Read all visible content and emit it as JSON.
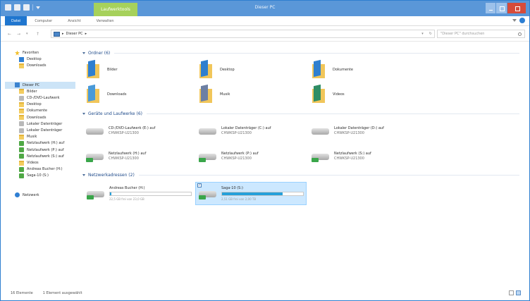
{
  "window": {
    "title": "Dieser PC",
    "context_tab": "Laufwerktools"
  },
  "ribbon": {
    "tabs": [
      "Datei",
      "Computer",
      "Ansicht",
      "Verwalten"
    ]
  },
  "address": {
    "path": [
      "Dieser PC"
    ],
    "search_placeholder": "\"Dieser PC\" durchsuchen"
  },
  "nav": {
    "favorites_label": "Favoriten",
    "favorites": [
      {
        "label": "Desktop",
        "icon": "desktop-icon"
      },
      {
        "label": "Downloads",
        "icon": "downloads-folder-icon"
      }
    ],
    "thispc_label": "Dieser PC",
    "thispc_items": [
      {
        "label": "Bilder",
        "icon": "folder-icon"
      },
      {
        "label": "CD-/DVD-Laufwerk",
        "icon": "drive-icon"
      },
      {
        "label": "Desktop",
        "icon": "folder-icon"
      },
      {
        "label": "Dokumente",
        "icon": "folder-icon"
      },
      {
        "label": "Downloads",
        "icon": "folder-icon"
      },
      {
        "label": "Lokaler Datenträger",
        "icon": "drive-icon"
      },
      {
        "label": "Lokaler Datenträger",
        "icon": "drive-icon"
      },
      {
        "label": "Musik",
        "icon": "folder-icon"
      },
      {
        "label": "Netzlaufwerk (H:) auf",
        "icon": "network-drive-icon"
      },
      {
        "label": "Netzlaufwerk (P:) auf",
        "icon": "network-drive-icon"
      },
      {
        "label": "Netzlaufwerk (S:) auf",
        "icon": "network-drive-icon"
      },
      {
        "label": "Videos",
        "icon": "folder-icon"
      },
      {
        "label": "Andreas Bucher (H:)",
        "icon": "network-drive-icon"
      },
      {
        "label": "Saga-10 (S:)",
        "icon": "network-drive-icon"
      }
    ],
    "network_label": "Netzwerk"
  },
  "content": {
    "folders_header": "Ordner (6)",
    "folders": [
      {
        "label": "Bilder",
        "kind": "pictures"
      },
      {
        "label": "Desktop",
        "kind": "desktop"
      },
      {
        "label": "Dokumente",
        "kind": "documents"
      },
      {
        "label": "Downloads",
        "kind": "downloads"
      },
      {
        "label": "Musik",
        "kind": "music"
      },
      {
        "label": "Videos",
        "kind": "videos"
      }
    ],
    "devices_header": "Geräte und Laufwerke (6)",
    "devices": [
      {
        "name": "CD-/DVD-Laufwerk (E:) auf",
        "host": "CHWKSP-U21300",
        "net": false
      },
      {
        "name": "Lokaler Datenträger (C:) auf",
        "host": "CHWKSP-U21300",
        "net": false
      },
      {
        "name": "Lokaler Datenträger (D:) auf",
        "host": "CHWKSP-U21300",
        "net": false
      },
      {
        "name": "Netzlaufwerk (H:) auf",
        "host": "CHWKSP-U21300",
        "net": true
      },
      {
        "name": "Netzlaufwerk (P:) auf",
        "host": "CHWKSP-U21300",
        "net": true
      },
      {
        "name": "Netzlaufwerk (S:) auf",
        "host": "CHWKSP-U21300",
        "net": true
      }
    ],
    "network_header": "Netzwerkadressen (2)",
    "locations": [
      {
        "name": "Andreas Bucher (H:)",
        "free": "22,5 GB frei von 23,0 GB",
        "fill": 0.02,
        "selected": false
      },
      {
        "name": "Saga-10 (S:)",
        "free": "2,51 GB frei von 2,00 TB",
        "fill": 0.75,
        "selected": true
      }
    ]
  },
  "status": {
    "count": "16 Elemente",
    "selection": "1 Element ausgewählt"
  }
}
